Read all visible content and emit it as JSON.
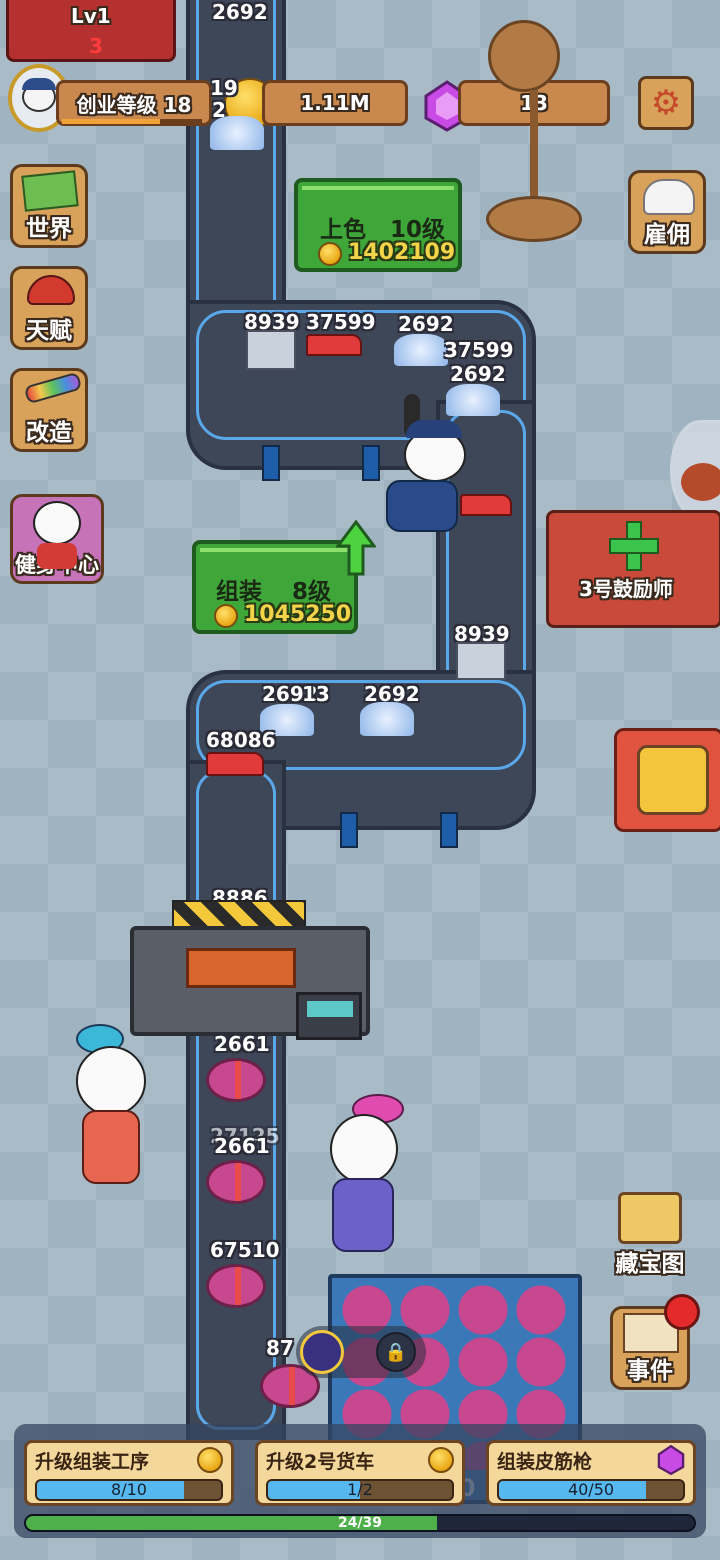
{
  "top": {
    "lv_label": "Lv1",
    "lv_sub": "3",
    "level_title": "创业等级 18",
    "coins": "1.11M",
    "gems": "13"
  },
  "side_left": [
    {
      "label": "世界"
    },
    {
      "label": "天赋"
    },
    {
      "label": "改造"
    },
    {
      "label": "健身中心"
    }
  ],
  "side_right": {
    "hire": "雇佣",
    "cheerleader": "3号鼓励师",
    "treasure_map": "藏宝图",
    "events": "事件"
  },
  "stations": [
    {
      "name": "上色",
      "level": "10级",
      "cost": "1402109"
    },
    {
      "name": "组装",
      "level": "8级",
      "cost": "1045250"
    }
  ],
  "items": {
    "top_stack": "2692",
    "top_a": "19",
    "top_b": "2",
    "row1": [
      "8939",
      "37599",
      "2692"
    ],
    "row1_right": [
      "37599",
      "2692"
    ],
    "mid_right": "8939",
    "row2": [
      "2692",
      "2692",
      "68086"
    ],
    "row2_overlap": "13",
    "machine": "8886",
    "cake1": "2661",
    "cake2_top": "27125",
    "cake2": "2661",
    "cake3": "67510",
    "cake4": "87",
    "crate_count": "50"
  },
  "upgrades": [
    {
      "title": "升级组装工序",
      "progress": "8/10",
      "fraction": 0.8,
      "currency": "coin"
    },
    {
      "title": "升级2号货车",
      "progress": "1/2",
      "fraction": 0.5,
      "currency": "coin"
    },
    {
      "title": "组装皮筋枪",
      "progress": "40/50",
      "fraction": 0.8,
      "currency": "gem"
    }
  ],
  "overall_progress": {
    "text": "24/39",
    "fraction": 0.615
  },
  "colors": {
    "background": "#9fb3c1",
    "station_green": "#3fa63a",
    "wood": "#c9884d",
    "gem": "#c94be6",
    "progress_blue": "#57b8ef",
    "progress_green": "#4fb04b"
  }
}
